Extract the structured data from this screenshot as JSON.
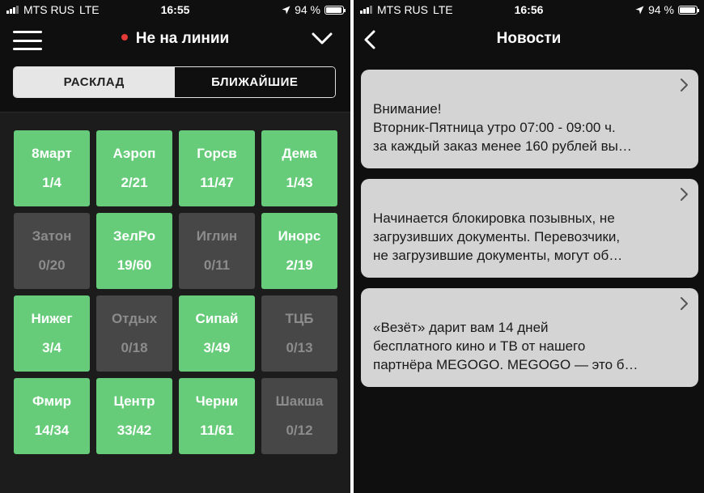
{
  "left_screen": {
    "status_bar": {
      "carrier": "MTS RUS",
      "network": "LTE",
      "time": "16:55",
      "battery": "94 %"
    },
    "nav": {
      "title": "Не на линии",
      "menu_icon": "hamburger-icon",
      "dropdown_icon": "chevron-down-icon",
      "status_color": "#e53935"
    },
    "segmented": {
      "tab1": "РАСКЛАД",
      "tab2": "БЛИЖАЙШИЕ",
      "active": "tab1"
    },
    "zones": [
      {
        "name": "8март",
        "count": "1/4",
        "active": true
      },
      {
        "name": "Аэроп",
        "count": "2/21",
        "active": true
      },
      {
        "name": "Горсв",
        "count": "11/47",
        "active": true
      },
      {
        "name": "Дема",
        "count": "1/43",
        "active": true
      },
      {
        "name": "Затон",
        "count": "0/20",
        "active": false
      },
      {
        "name": "ЗелРо",
        "count": "19/60",
        "active": true
      },
      {
        "name": "Иглин",
        "count": "0/11",
        "active": false
      },
      {
        "name": "Инорс",
        "count": "2/19",
        "active": true
      },
      {
        "name": "Нижег",
        "count": "3/4",
        "active": true
      },
      {
        "name": "Отдых",
        "count": "0/18",
        "active": false
      },
      {
        "name": "Сипай",
        "count": "3/49",
        "active": true
      },
      {
        "name": "ТЦБ",
        "count": "0/13",
        "active": false
      },
      {
        "name": "Фмир",
        "count": "14/34",
        "active": true
      },
      {
        "name": "Центр",
        "count": "33/42",
        "active": true
      },
      {
        "name": "Черни",
        "count": "11/61",
        "active": true
      },
      {
        "name": "Шакша",
        "count": "0/12",
        "active": false
      }
    ],
    "colors": {
      "active_tile": "#66cc7a",
      "inactive_tile": "#474747"
    }
  },
  "right_screen": {
    "status_bar": {
      "carrier": "MTS RUS",
      "network": "LTE",
      "time": "16:56",
      "battery": "94 %"
    },
    "nav": {
      "title": "Новости",
      "back_icon": "chevron-left-icon"
    },
    "news": [
      {
        "lines": [
          "Внимание!",
          "Вторник-Пятница утро 07:00 - 09:00 ч.",
          "за каждый заказ менее 160 рублей вы…"
        ]
      },
      {
        "lines": [
          "Начинается блокировка позывных, не",
          "загрузивших документы. Перевозчики,",
          "не загрузившие документы, могут об…"
        ]
      },
      {
        "lines": [
          "«Везёт» дарит вам 14 дней",
          "бесплатного кино и ТВ от нашего",
          "партнёра MEGOGO. MEGOGO — это б…"
        ]
      }
    ]
  }
}
